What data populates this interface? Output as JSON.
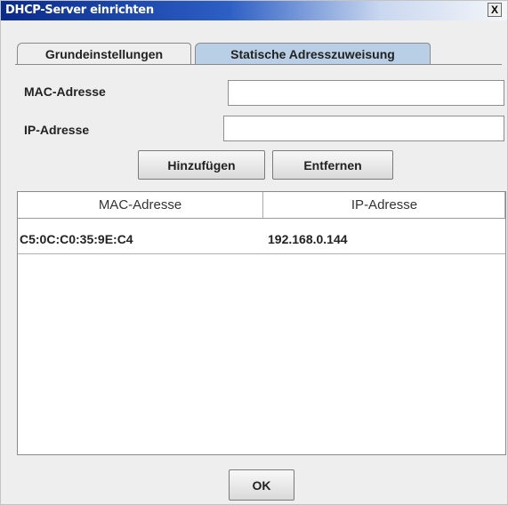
{
  "window": {
    "title": "DHCP-Server einrichten",
    "close_label": "X"
  },
  "tabs": [
    {
      "label": "Grundeinstellungen",
      "active": false
    },
    {
      "label": "Statische Adresszuweisung",
      "active": true
    }
  ],
  "form": {
    "mac_label": "MAC-Adresse",
    "mac_value": "",
    "ip_label": "IP-Adresse",
    "ip_value": ""
  },
  "actions": {
    "add_label": "Hinzufügen",
    "remove_label": "Entfernen"
  },
  "table": {
    "columns": [
      "MAC-Adresse",
      "IP-Adresse"
    ],
    "rows": [
      {
        "mac": "C5:0C:C0:35:9E:C4",
        "ip": "192.168.0.144"
      }
    ]
  },
  "footer": {
    "ok_label": "OK"
  }
}
